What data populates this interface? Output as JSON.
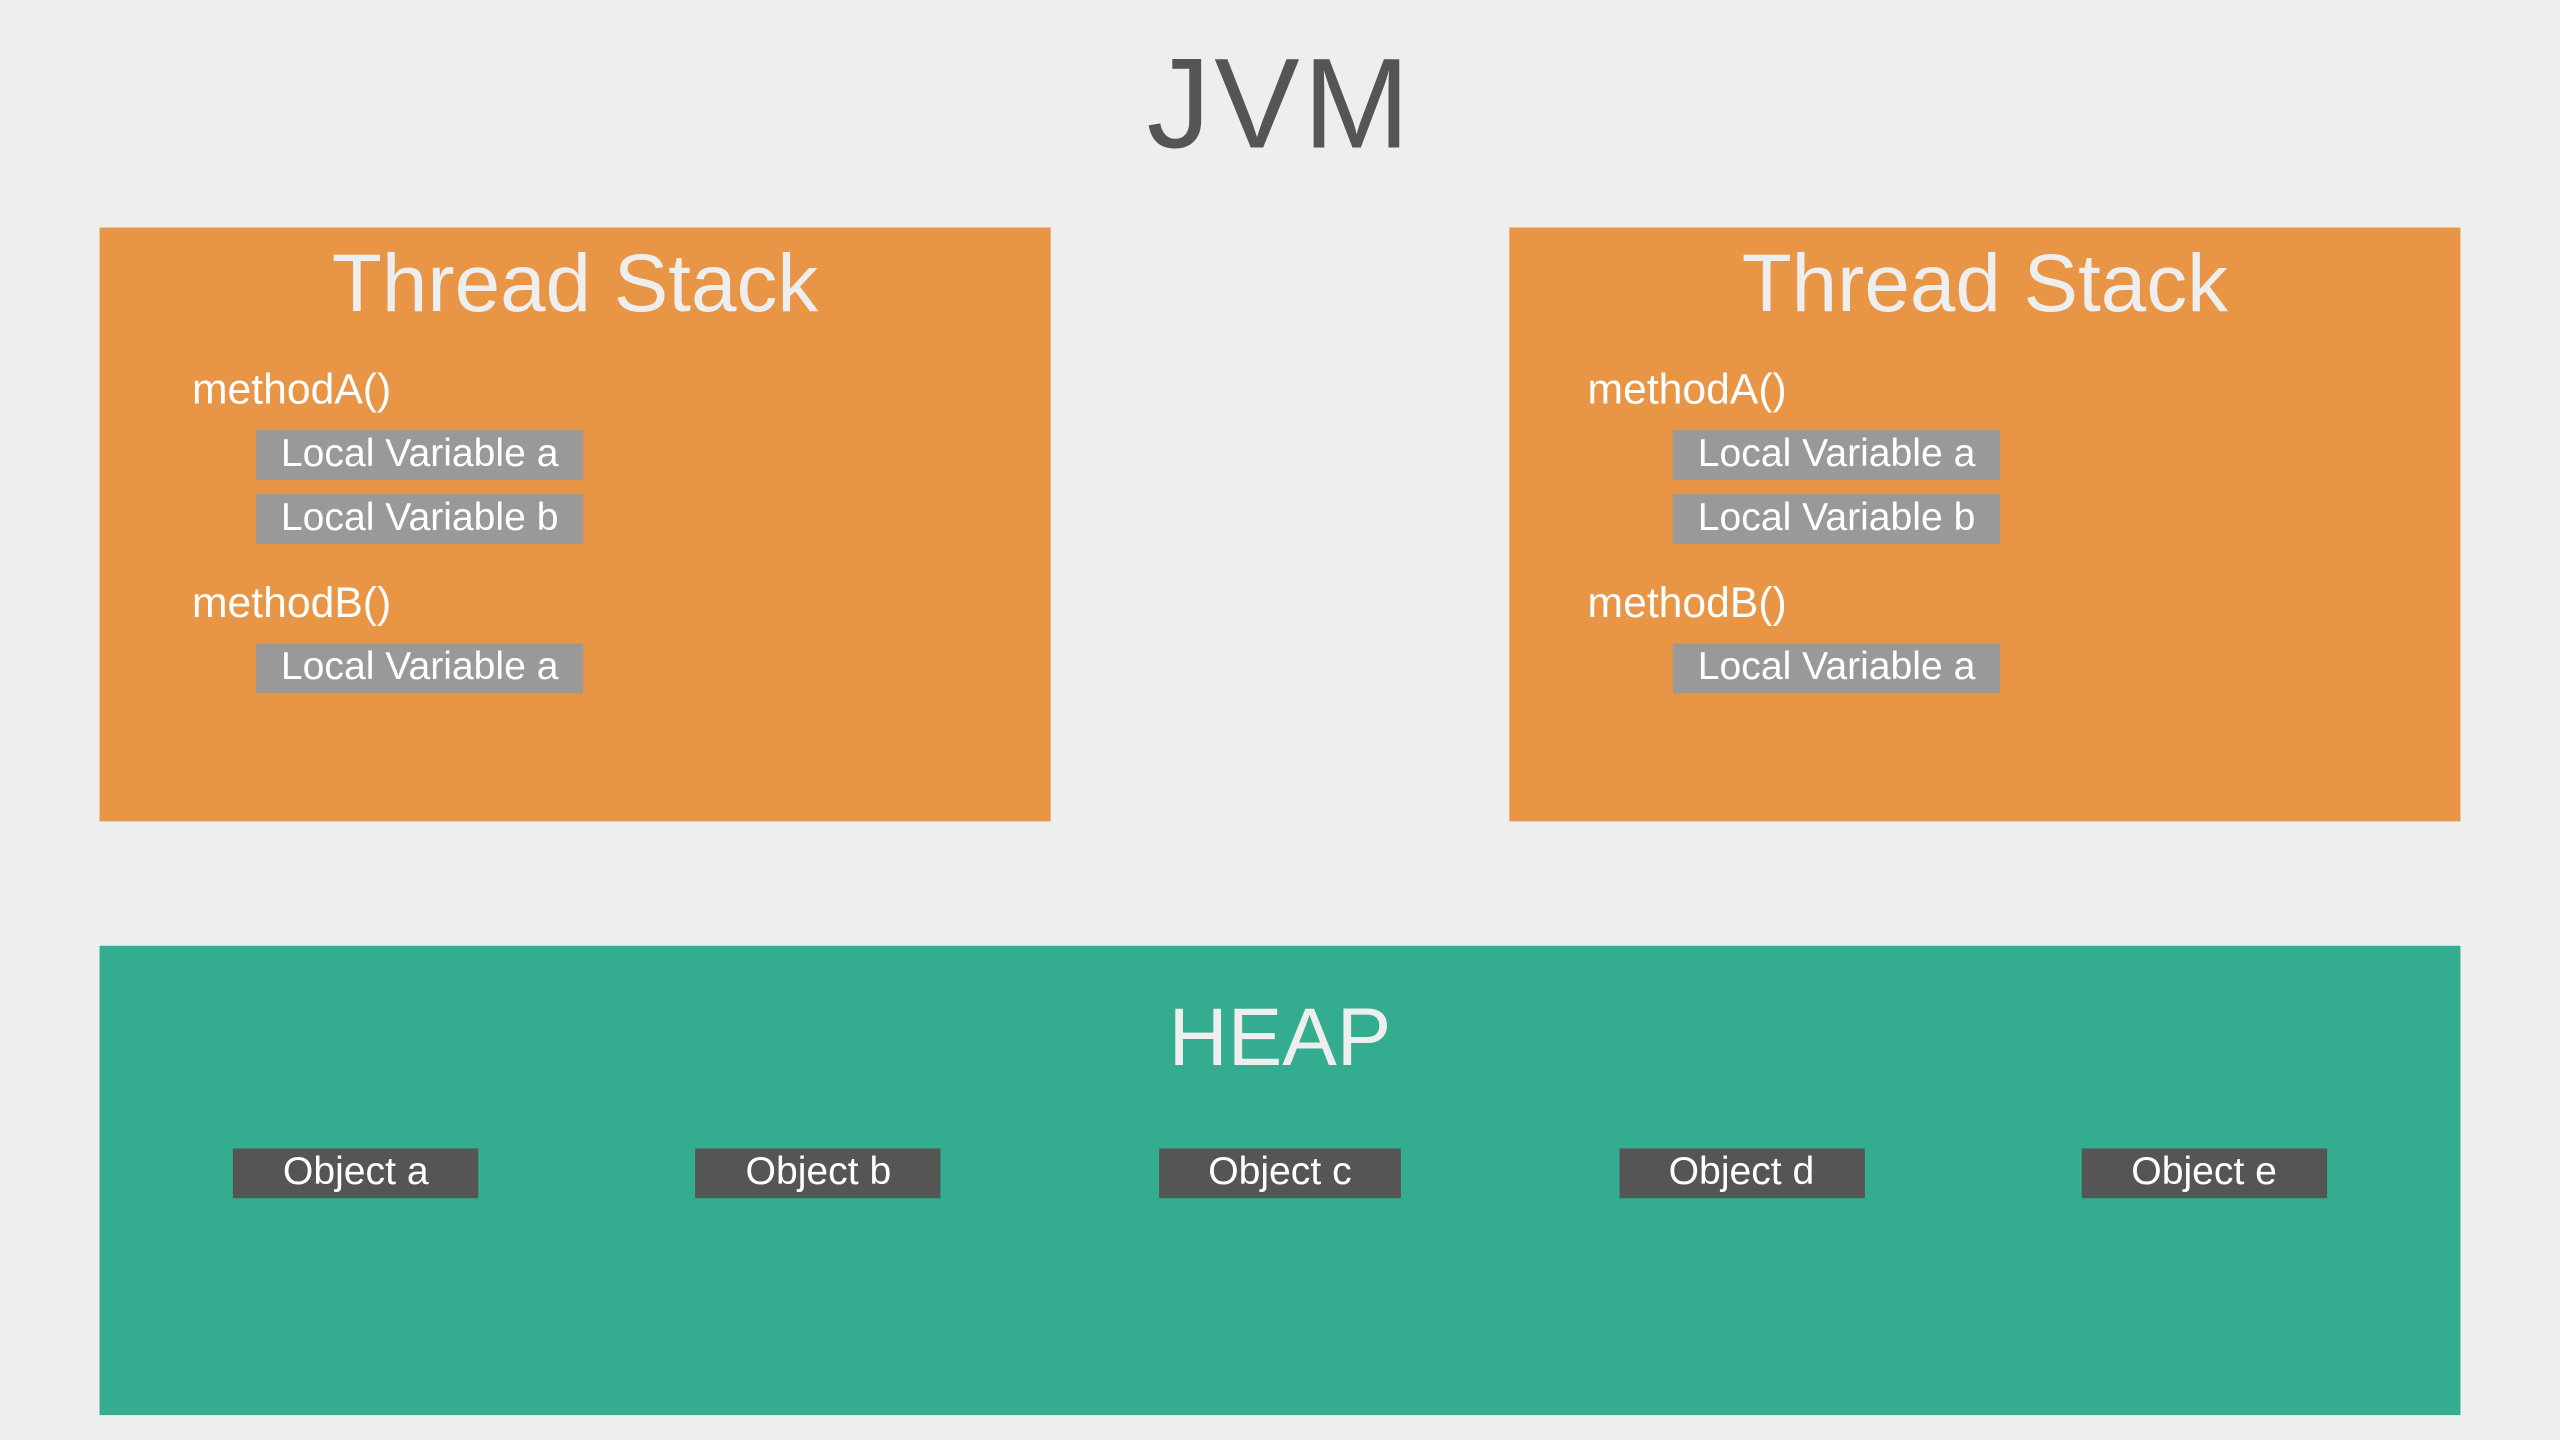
{
  "title": "JVM",
  "colors": {
    "bg": "#eeeeee",
    "stack_bg": "#e89545",
    "heap_bg": "#34ac90",
    "var_bg": "#999999",
    "obj_bg": "#555555",
    "title_color": "#555555",
    "header_text": "#eeeeee",
    "text": "#ffffff"
  },
  "stacks": [
    {
      "title": "Thread Stack",
      "frames": [
        {
          "method": "methodA()",
          "locals": [
            "Local Variable a",
            "Local Variable b"
          ]
        },
        {
          "method": "methodB()",
          "locals": [
            "Local Variable a"
          ]
        }
      ]
    },
    {
      "title": "Thread Stack",
      "frames": [
        {
          "method": "methodA()",
          "locals": [
            "Local Variable a",
            "Local Variable b"
          ]
        },
        {
          "method": "methodB()",
          "locals": [
            "Local Variable a"
          ]
        }
      ]
    }
  ],
  "heap": {
    "title": "HEAP",
    "objects": [
      "Object a",
      "Object b",
      "Object c",
      "Object d",
      "Object e"
    ]
  }
}
